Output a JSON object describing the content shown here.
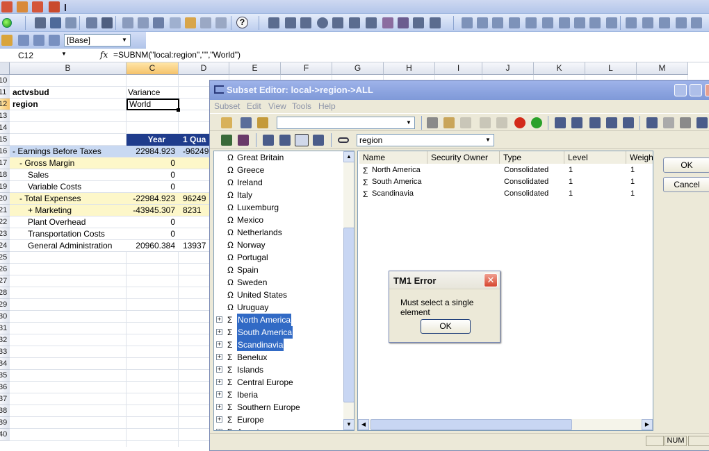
{
  "formula_bar": {
    "cell_ref": "C12",
    "fx": "fx",
    "formula": "=SUBNM(\"local:region\",\"\",\"World\")"
  },
  "toolbar2": {
    "dropdown_value": "[Base]"
  },
  "sheet": {
    "columns": [
      "B",
      "C",
      "D",
      "E",
      "F",
      "G",
      "H",
      "I",
      "J",
      "K",
      "L",
      "M"
    ],
    "rows": [
      "10",
      "11",
      "12",
      "13",
      "14",
      "15",
      "16",
      "17",
      "18",
      "19",
      "20",
      "21",
      "22",
      "23",
      "24",
      "25",
      "26",
      "27",
      "28",
      "29",
      "30",
      "31",
      "32",
      "33",
      "34",
      "35",
      "36",
      "37",
      "38",
      "39",
      "40"
    ],
    "b11": "actvsbud",
    "c11": "Variance",
    "b12": "region",
    "c12": "World",
    "c15": "Year",
    "d15": "1 Qua",
    "lines": [
      {
        "label": "- Earnings Before Taxes",
        "c": "22984.923",
        "d": "-96249"
      },
      {
        "label": "- Gross Margin",
        "c": "0",
        "d": ""
      },
      {
        "label": "Sales",
        "c": "0",
        "d": ""
      },
      {
        "label": "Variable Costs",
        "c": "0",
        "d": ""
      },
      {
        "label": "- Total Expenses",
        "c": "-22984.923",
        "d": "96249"
      },
      {
        "label": "+ Marketing",
        "c": "-43945.307",
        "d": "8231"
      },
      {
        "label": "Plant Overhead",
        "c": "0",
        "d": ""
      },
      {
        "label": "Transportation Costs",
        "c": "0",
        "d": ""
      },
      {
        "label": "General Administration",
        "c": "20960.384",
        "d": "13937"
      }
    ]
  },
  "subset_editor": {
    "title": "Subset Editor:  local->region->ALL",
    "menu": [
      "Subset",
      "Edit",
      "View",
      "Tools",
      "Help"
    ],
    "dimension_select": "region",
    "ok_label": "OK",
    "cancel_label": "Cancel",
    "tree_items": [
      {
        "label": "Great Britain",
        "type": "leaf"
      },
      {
        "label": "Greece",
        "type": "leaf"
      },
      {
        "label": "Ireland",
        "type": "leaf"
      },
      {
        "label": "Italy",
        "type": "leaf"
      },
      {
        "label": "Luxemburg",
        "type": "leaf"
      },
      {
        "label": "Mexico",
        "type": "leaf"
      },
      {
        "label": "Netherlands",
        "type": "leaf"
      },
      {
        "label": "Norway",
        "type": "leaf"
      },
      {
        "label": "Portugal",
        "type": "leaf"
      },
      {
        "label": "Spain",
        "type": "leaf"
      },
      {
        "label": "Sweden",
        "type": "leaf"
      },
      {
        "label": "United States",
        "type": "leaf"
      },
      {
        "label": "Uruguay",
        "type": "leaf"
      },
      {
        "label": "North America",
        "type": "cons",
        "selected": true
      },
      {
        "label": "South America",
        "type": "cons",
        "selected": true
      },
      {
        "label": "Scandinavia",
        "type": "cons",
        "selected": true
      },
      {
        "label": "Benelux",
        "type": "cons"
      },
      {
        "label": "Islands",
        "type": "cons"
      },
      {
        "label": "Central Europe",
        "type": "cons"
      },
      {
        "label": "Iberia",
        "type": "cons"
      },
      {
        "label": "Southern Europe",
        "type": "cons"
      },
      {
        "label": "Europe",
        "type": "cons"
      },
      {
        "label": "Americas",
        "type": "cons"
      }
    ],
    "grid_headers": [
      "Name",
      "Security Owner",
      "Type",
      "Level",
      "Weigh"
    ],
    "grid_rows": [
      {
        "name": "North America",
        "owner": "",
        "type": "Consolidated",
        "level": "1",
        "weight": "1"
      },
      {
        "name": "South America",
        "owner": "",
        "type": "Consolidated",
        "level": "1",
        "weight": "1"
      },
      {
        "name": "Scandinavia",
        "owner": "",
        "type": "Consolidated",
        "level": "1",
        "weight": "1"
      }
    ],
    "status_num": "NUM"
  },
  "error_dialog": {
    "title": "TM1 Error",
    "message": "Must select a single element",
    "ok_label": "OK"
  }
}
